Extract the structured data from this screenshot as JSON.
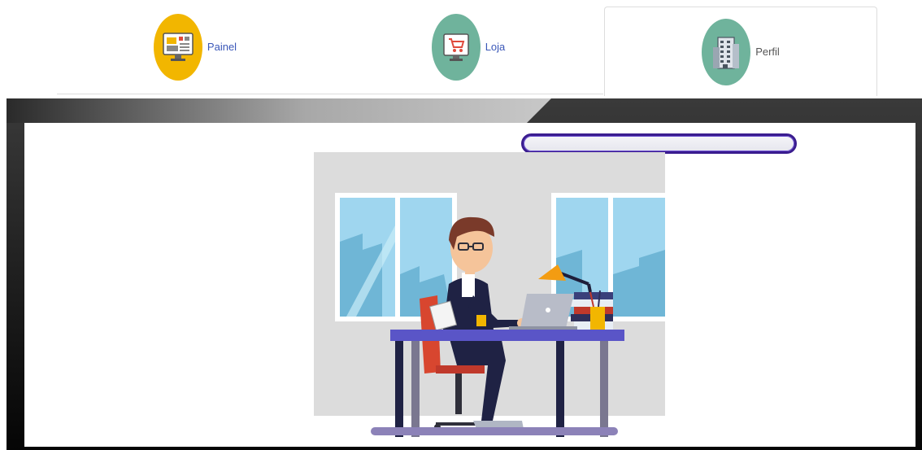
{
  "tabs": [
    {
      "label": "Painel",
      "icon": "dashboard-monitor-icon",
      "color": "#f2b600",
      "active": false
    },
    {
      "label": "Loja",
      "icon": "shopping-cart-icon",
      "color": "#6fb39c",
      "active": false
    },
    {
      "label": "Perfil",
      "icon": "building-icon",
      "color": "#6fb39c",
      "active": true
    }
  ],
  "colors": {
    "tab_link": "#3a57b8",
    "frame_dark": "#111111",
    "pill_border": "#3a1c8f"
  },
  "illustration": {
    "subject": "person-working-at-desk-illustration"
  }
}
